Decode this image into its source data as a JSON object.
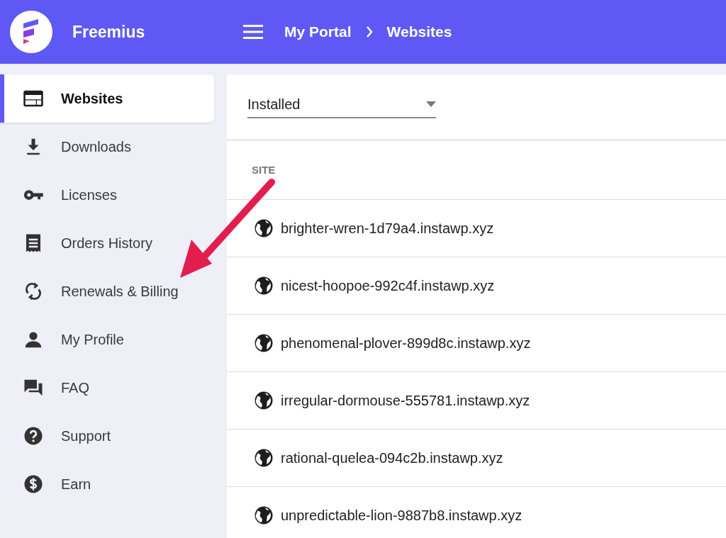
{
  "header": {
    "brand": "Freemius",
    "breadcrumb": [
      "My Portal",
      "Websites"
    ]
  },
  "sidebar": {
    "items": [
      {
        "label": "Websites",
        "selected": true
      },
      {
        "label": "Downloads",
        "selected": false
      },
      {
        "label": "Licenses",
        "selected": false
      },
      {
        "label": "Orders History",
        "selected": false
      },
      {
        "label": "Renewals & Billing",
        "selected": false
      },
      {
        "label": "My Profile",
        "selected": false
      },
      {
        "label": "FAQ",
        "selected": false
      },
      {
        "label": "Support",
        "selected": false
      },
      {
        "label": "Earn",
        "selected": false
      }
    ]
  },
  "filter": {
    "value": "Installed"
  },
  "table": {
    "columns": [
      "SITE"
    ],
    "rows": [
      "brighter-wren-1d79a4.instawp.xyz",
      "nicest-hoopoe-992c4f.instawp.xyz",
      "phenomenal-plover-899d8c.instawp.xyz",
      "irregular-dormouse-555781.instawp.xyz",
      "rational-quelea-094c2b.instawp.xyz",
      "unpredictable-lion-9887b8.instawp.xyz"
    ]
  }
}
